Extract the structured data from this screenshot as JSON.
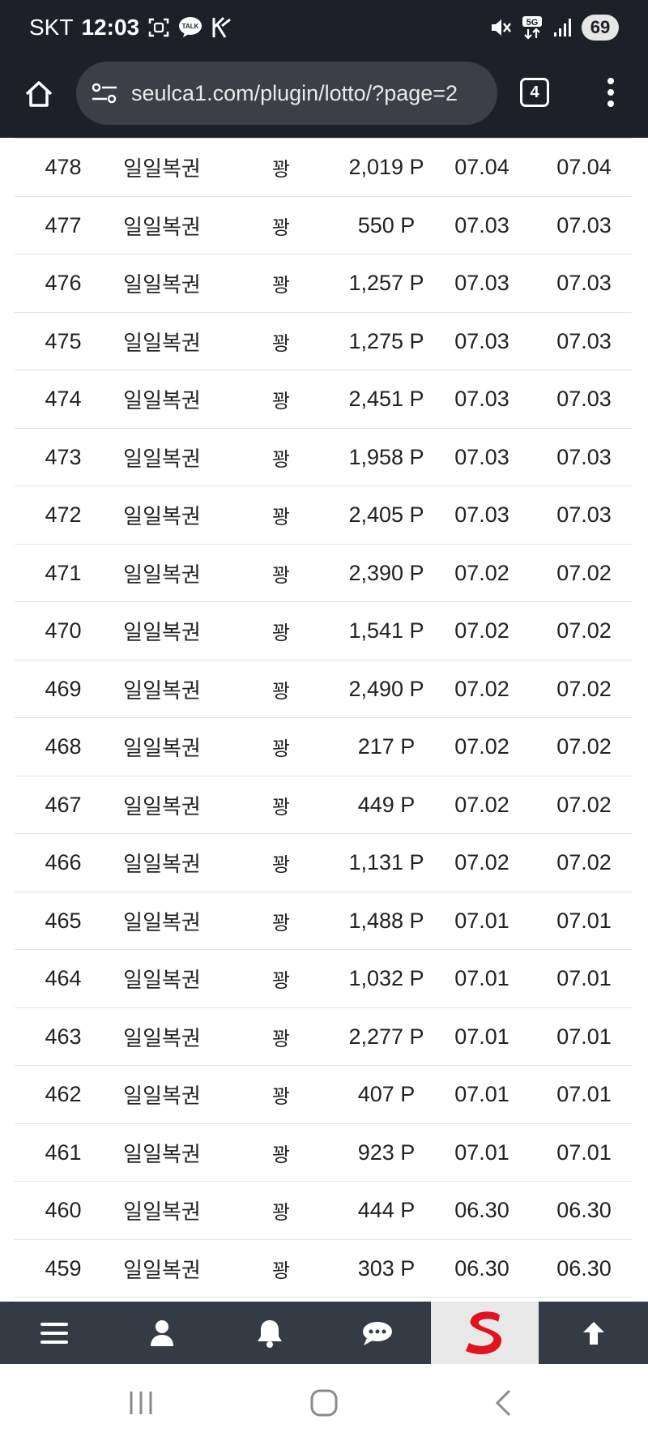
{
  "status_bar": {
    "carrier": "SKT",
    "time": "12:03",
    "talk_badge": "TALK",
    "network": "5G",
    "battery": "69"
  },
  "browser": {
    "url": "seulca1.com/plugin/lotto/?page=2",
    "tab_count": "4"
  },
  "rows": [
    {
      "no": "478",
      "type": "일일복권",
      "result": "꽝",
      "point": "2,019 P",
      "date1": "07.04",
      "date2": "07.04"
    },
    {
      "no": "477",
      "type": "일일복권",
      "result": "꽝",
      "point": "550 P",
      "date1": "07.03",
      "date2": "07.03"
    },
    {
      "no": "476",
      "type": "일일복권",
      "result": "꽝",
      "point": "1,257 P",
      "date1": "07.03",
      "date2": "07.03"
    },
    {
      "no": "475",
      "type": "일일복권",
      "result": "꽝",
      "point": "1,275 P",
      "date1": "07.03",
      "date2": "07.03"
    },
    {
      "no": "474",
      "type": "일일복권",
      "result": "꽝",
      "point": "2,451 P",
      "date1": "07.03",
      "date2": "07.03"
    },
    {
      "no": "473",
      "type": "일일복권",
      "result": "꽝",
      "point": "1,958 P",
      "date1": "07.03",
      "date2": "07.03"
    },
    {
      "no": "472",
      "type": "일일복권",
      "result": "꽝",
      "point": "2,405 P",
      "date1": "07.03",
      "date2": "07.03"
    },
    {
      "no": "471",
      "type": "일일복권",
      "result": "꽝",
      "point": "2,390 P",
      "date1": "07.02",
      "date2": "07.02"
    },
    {
      "no": "470",
      "type": "일일복권",
      "result": "꽝",
      "point": "1,541 P",
      "date1": "07.02",
      "date2": "07.02"
    },
    {
      "no": "469",
      "type": "일일복권",
      "result": "꽝",
      "point": "2,490 P",
      "date1": "07.02",
      "date2": "07.02"
    },
    {
      "no": "468",
      "type": "일일복권",
      "result": "꽝",
      "point": "217 P",
      "date1": "07.02",
      "date2": "07.02"
    },
    {
      "no": "467",
      "type": "일일복권",
      "result": "꽝",
      "point": "449 P",
      "date1": "07.02",
      "date2": "07.02"
    },
    {
      "no": "466",
      "type": "일일복권",
      "result": "꽝",
      "point": "1,131 P",
      "date1": "07.02",
      "date2": "07.02"
    },
    {
      "no": "465",
      "type": "일일복권",
      "result": "꽝",
      "point": "1,488 P",
      "date1": "07.01",
      "date2": "07.01"
    },
    {
      "no": "464",
      "type": "일일복권",
      "result": "꽝",
      "point": "1,032 P",
      "date1": "07.01",
      "date2": "07.01"
    },
    {
      "no": "463",
      "type": "일일복권",
      "result": "꽝",
      "point": "2,277 P",
      "date1": "07.01",
      "date2": "07.01"
    },
    {
      "no": "462",
      "type": "일일복권",
      "result": "꽝",
      "point": "407 P",
      "date1": "07.01",
      "date2": "07.01"
    },
    {
      "no": "461",
      "type": "일일복권",
      "result": "꽝",
      "point": "923 P",
      "date1": "07.01",
      "date2": "07.01"
    },
    {
      "no": "460",
      "type": "일일복권",
      "result": "꽝",
      "point": "444 P",
      "date1": "06.30",
      "date2": "06.30"
    },
    {
      "no": "459",
      "type": "일일복권",
      "result": "꽝",
      "point": "303 P",
      "date1": "06.30",
      "date2": "06.30"
    }
  ],
  "site_nav": {
    "items": [
      {
        "icon": "hamburger-menu-icon"
      },
      {
        "icon": "user-icon"
      },
      {
        "icon": "bell-icon"
      },
      {
        "icon": "chat-bubble-icon"
      },
      {
        "icon": "site-logo-s"
      },
      {
        "icon": "arrow-up-icon"
      }
    ]
  },
  "colors": {
    "chrome_dark": "#1e2027",
    "url_pill": "#3c3f46",
    "site_nav_bg": "#353b45",
    "logo_red": "#e0141e",
    "row_divider": "#e3e3e3"
  }
}
